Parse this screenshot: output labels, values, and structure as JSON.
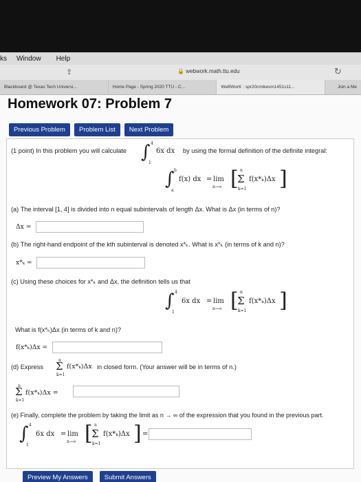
{
  "menu": {
    "items": [
      "ks",
      "Window",
      "Help"
    ]
  },
  "toolbar": {
    "url": "webwork.math.ttu.edu"
  },
  "tabs": [
    "Blackboard @ Texas Tech Universi...",
    "Home Page - Spring 2020 TTU - C...",
    "WeBWorK : spr20cmikesm1451s11...",
    "Join a Me"
  ],
  "page": {
    "title": "Homework 07: Problem 7"
  },
  "nav": {
    "previous": "Previous Problem",
    "list": "Problem List",
    "next": "Next Problem"
  },
  "problem": {
    "intro_pre": "(1 point) In this problem you will calculate",
    "intro_mid": "6x dx",
    "intro_post": "by using the formal definition of the definite integral:",
    "int_lower": "1",
    "int_upper": "4",
    "def_lower": "a",
    "def_upper": "b",
    "def_integrand": "f(x) dx",
    "lim": "lim",
    "lim_sub": "n→∞",
    "sum_top": "n",
    "sum_bottom": "k=1",
    "sum_term": "f(x*ₖ)Δx",
    "eq": "=",
    "part_a": "(a) The interval [1, 4] is divided into n equal subintervals of length Δx. What is Δx (in terms of n)?",
    "label_a": "Δx =",
    "part_b": "(b) The right-hand endpoint of the kth subinterval is denoted x*ₖ. What is x*ₖ (in terms of k and n)?",
    "label_b": "x*ₖ =",
    "part_c": "(c) Using these choices for x*ₖ and Δx, the definition tells us that",
    "integrand_6x": "6x dx",
    "question_f": "What is f(x*ₖ)Δx (in terms of k and n)?",
    "label_f": "f(x*ₖ)Δx =",
    "part_d_pre": "(d) Express",
    "part_d_post": "in closed form. (Your answer will be in terms of n.)",
    "label_sum": "f(x*ₖ)Δx =",
    "part_e": "(e) Finally, complete the problem by taking the limit as n → ∞ of the expression that you found in the previous part.",
    "equals": "="
  },
  "actions": {
    "preview": "Preview My Answers",
    "submit": "Submit Answers"
  }
}
